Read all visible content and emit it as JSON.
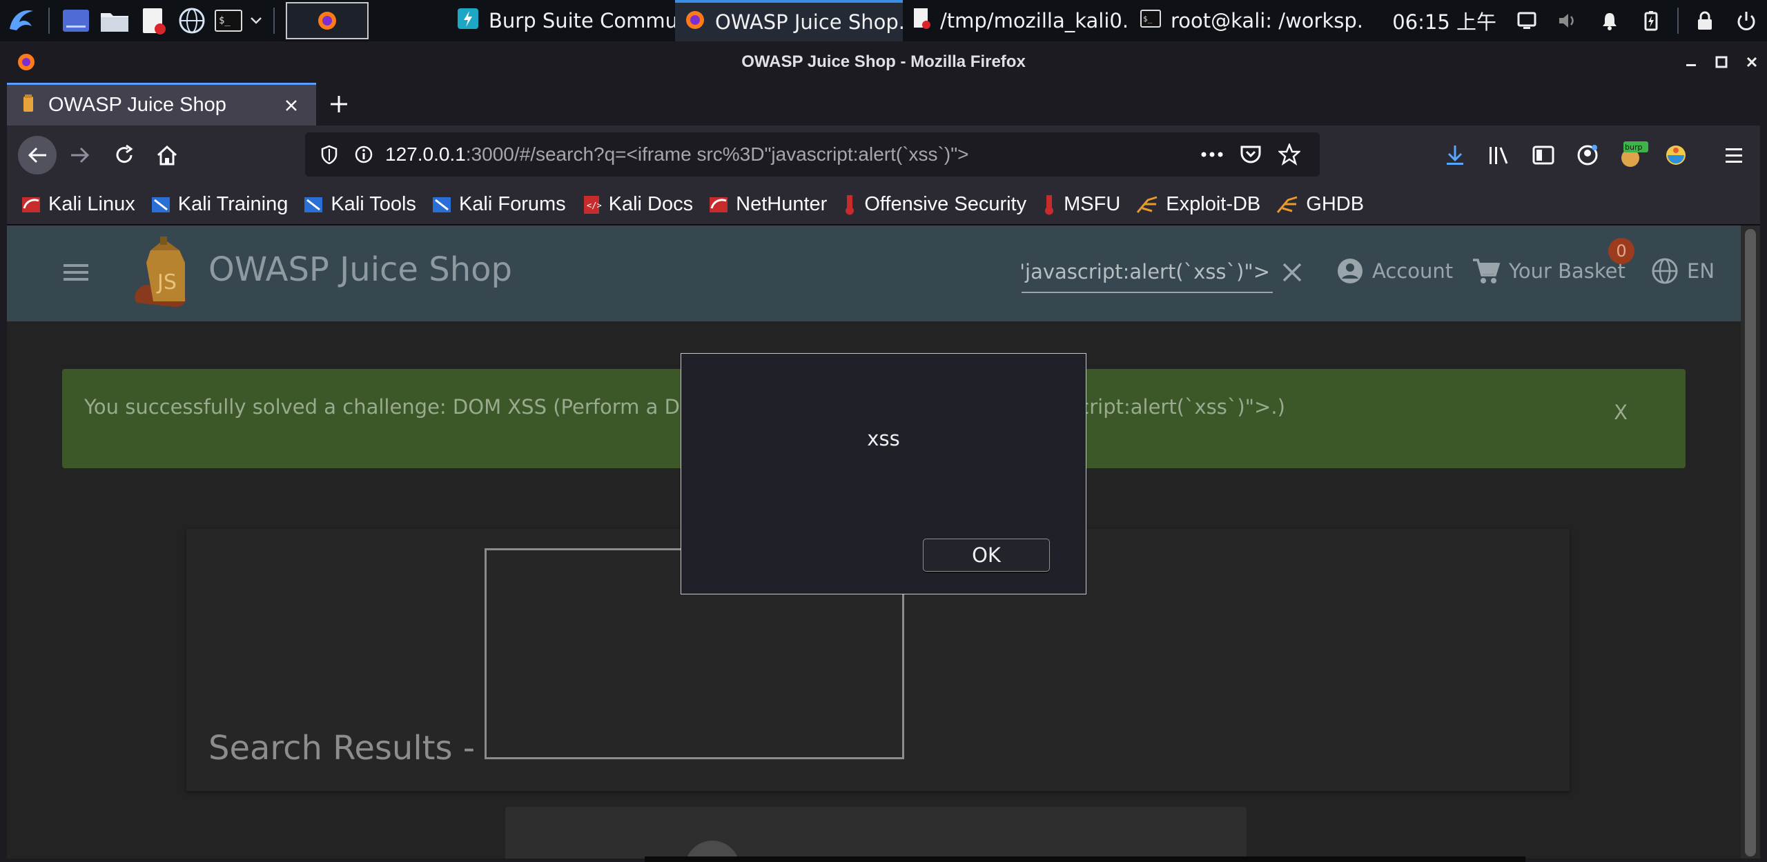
{
  "panel": {
    "tasks": [
      {
        "label": "Burp Suite Commu..."
      },
      {
        "label": "OWASP Juice Shop..."
      },
      {
        "label": "/tmp/mozilla_kali0..."
      },
      {
        "label": "root@kali: /worksp..."
      }
    ],
    "clock": "06:15 上午"
  },
  "window": {
    "title": "OWASP Juice Shop - Mozilla Firefox"
  },
  "tab": {
    "label": "OWASP Juice Shop"
  },
  "urlbar": {
    "host": "127.0.0.1",
    "path": ":3000/#/search?q=<iframe src%3D\"javascript:alert(`xss`)\">"
  },
  "bookmarks": [
    {
      "label": "Kali Linux"
    },
    {
      "label": "Kali Training"
    },
    {
      "label": "Kali Tools"
    },
    {
      "label": "Kali Forums"
    },
    {
      "label": "Kali Docs"
    },
    {
      "label": "NetHunter"
    },
    {
      "label": "Offensive Security"
    },
    {
      "label": "MSFU"
    },
    {
      "label": "Exploit-DB"
    },
    {
      "label": "GHDB"
    }
  ],
  "app": {
    "title": "OWASP Juice Shop",
    "search_value": "=\"javascript:alert(`xss`)\">",
    "account_label": "Account",
    "basket_label": "Your Basket",
    "basket_count": "0",
    "language": "EN"
  },
  "challenge": {
    "message": "You successfully solved a challenge: DOM XSS (Perform a DOM XSS attack with <iframe src=\"javascript:alert(`xss`)\">.)",
    "close_label": "X"
  },
  "results": {
    "title": "Search Results -"
  },
  "alert": {
    "message": "xss",
    "ok_label": "OK"
  },
  "colors": {
    "appbar": "#37474f",
    "success": "#3c5728",
    "accent": "#5a9eff"
  }
}
